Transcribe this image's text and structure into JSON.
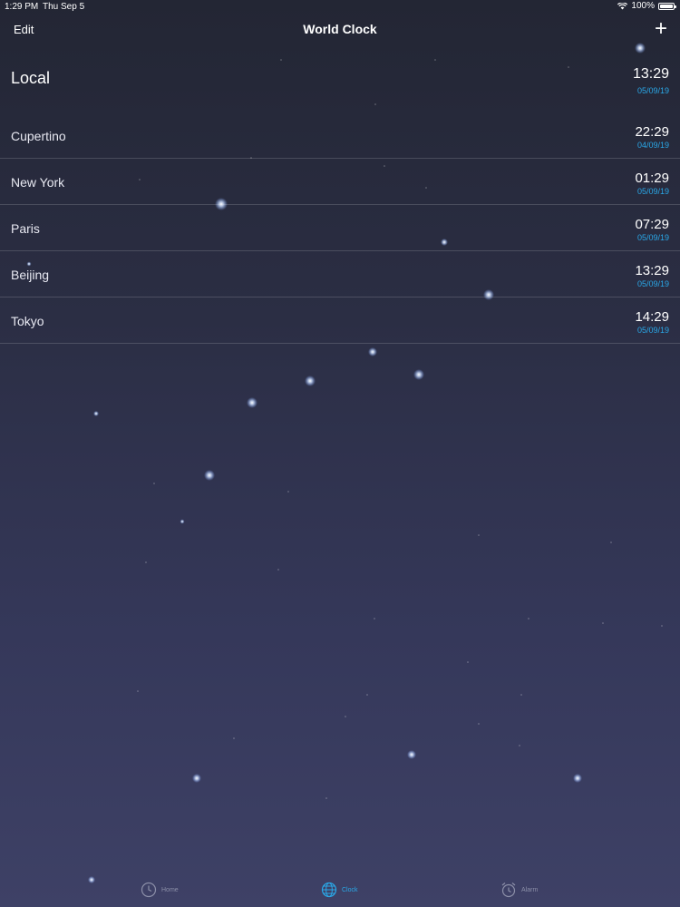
{
  "status_bar": {
    "time": "1:29 PM",
    "date": "Thu Sep 5",
    "battery": "100%",
    "icons": [
      "wifi-icon",
      "battery-icon"
    ]
  },
  "nav": {
    "edit_label": "Edit",
    "title": "World Clock",
    "add_label": "+"
  },
  "local": {
    "name": "Local",
    "time": "13:29",
    "date": "05/09/19"
  },
  "cities": [
    {
      "name": "Cupertino",
      "time": "22:29",
      "date": "04/09/19"
    },
    {
      "name": "New York",
      "time": "01:29",
      "date": "05/09/19"
    },
    {
      "name": "Paris",
      "time": "07:29",
      "date": "05/09/19"
    },
    {
      "name": "Beijing",
      "time": "13:29",
      "date": "05/09/19"
    },
    {
      "name": "Tokyo",
      "time": "14:29",
      "date": "05/09/19"
    }
  ],
  "tabs": [
    {
      "label": "Home",
      "icon": "home-clock-icon",
      "active": false
    },
    {
      "label": "Clock",
      "icon": "globe-icon",
      "active": true
    },
    {
      "label": "Alarm",
      "icon": "alarm-clock-icon",
      "active": false
    }
  ],
  "colors": {
    "accent": "#2aa8e8",
    "background_top": "#232634",
    "background_bottom": "#3e4166",
    "inactive_tab": "#8c8fa8"
  }
}
